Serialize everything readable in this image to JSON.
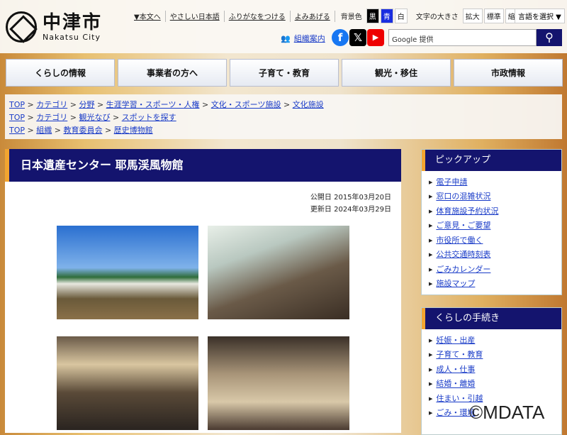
{
  "logo": {
    "jp": "中津市",
    "en": "Nakatsu City"
  },
  "toplinks": {
    "skip": "▼本文へ",
    "easy": "やさしい日本語",
    "furigana": "ふりがなをつける",
    "read": "よみあげる",
    "bg_label": "背景色",
    "bg": [
      "黒",
      "青",
      "白"
    ],
    "size_label": "文字の大きさ",
    "sizes": [
      "拡大",
      "標準",
      "縮小"
    ],
    "lang": "言語を選択 ▼"
  },
  "org": "組織案内",
  "sns": [
    "f",
    "𝕏",
    "▶"
  ],
  "search": {
    "placeholder": "Google 提供",
    "icon": "search-icon"
  },
  "nav": [
    "くらしの情報",
    "事業者の方へ",
    "子育て・教育",
    "観光・移住",
    "市政情報"
  ],
  "breadcrumbs": [
    [
      "TOP",
      "カテゴリ",
      "分野",
      "生涯学習・スポーツ・人権",
      "文化・スポーツ施設",
      "文化施設"
    ],
    [
      "TOP",
      "カテゴリ",
      "観光なび",
      "スポットを探す"
    ],
    [
      "TOP",
      "組織",
      "教育委員会",
      "歴史博物館"
    ]
  ],
  "page": {
    "title": "日本遺産センター 耶馬渓風物館",
    "published": "公開日 2015年03月20日",
    "updated": "更新日 2024年03月29日"
  },
  "pickup": {
    "title": "ピックアップ",
    "items": [
      "電子申請",
      "窓口の混雑状況",
      "体育施設予約状況",
      "ご意見・ご要望",
      "市役所で働く",
      "公共交通時刻表",
      "ごみカレンダー",
      "施設マップ"
    ]
  },
  "procedures": {
    "title": "くらしの手続き",
    "items": [
      "妊娠・出産",
      "子育て・教育",
      "成人・仕事",
      "結婚・離婚",
      "住まい・引越",
      "ごみ・環境"
    ]
  },
  "watermark": "©MDATA"
}
